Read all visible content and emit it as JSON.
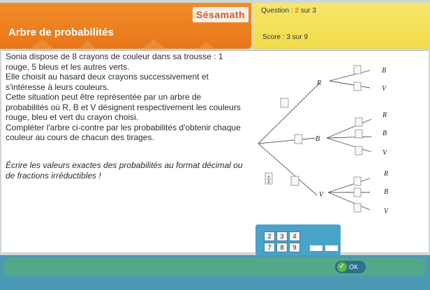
{
  "header": {
    "logo": "Sésamath",
    "title": "Arbre de probabilités",
    "question_prefix": "Question : ",
    "question_current": "2",
    "question_suffix": " sur 3",
    "score": "Score : 3 sur 9"
  },
  "statement": [
    "Sonia dispose de 8 crayons de couleur dans sa trousse : 1",
    "rouge, 5 bleus et les autres verts.",
    "Elle choisit au hasard deux crayons successivement et",
    "s'intéresse à leurs couleurs.",
    "Cette situation peut être représentée par un arbre de",
    "probabilités où R, B et V désignent respectivement les couleurs",
    "rouge, bleu et vert du crayon choisi.",
    "Compléter l'arbre ci-contre par les probabilités d'obtenir chaque",
    "couleur au cours de chacun des tirages."
  ],
  "instruction": [
    "Écrire les valeurs exactes des probabilités au format décimal ou",
    "de fractions irréductibles !"
  ],
  "tree": {
    "first_level": [
      "R",
      "B",
      "V"
    ],
    "second_level": [
      "R",
      "B",
      "V"
    ],
    "fraction_button": {
      "num": "a",
      "den": "b"
    }
  },
  "keypad": {
    "row1": [
      "2",
      "3",
      "4"
    ],
    "row2": [
      "7",
      "8",
      "9"
    ]
  },
  "footer": {
    "ok_label": "OK"
  },
  "colors": {
    "header_orange": "#e8761a",
    "header_yellow": "#f2dc4c",
    "footer_blue": "#4a9ab6",
    "bar_green": "#52a889"
  }
}
